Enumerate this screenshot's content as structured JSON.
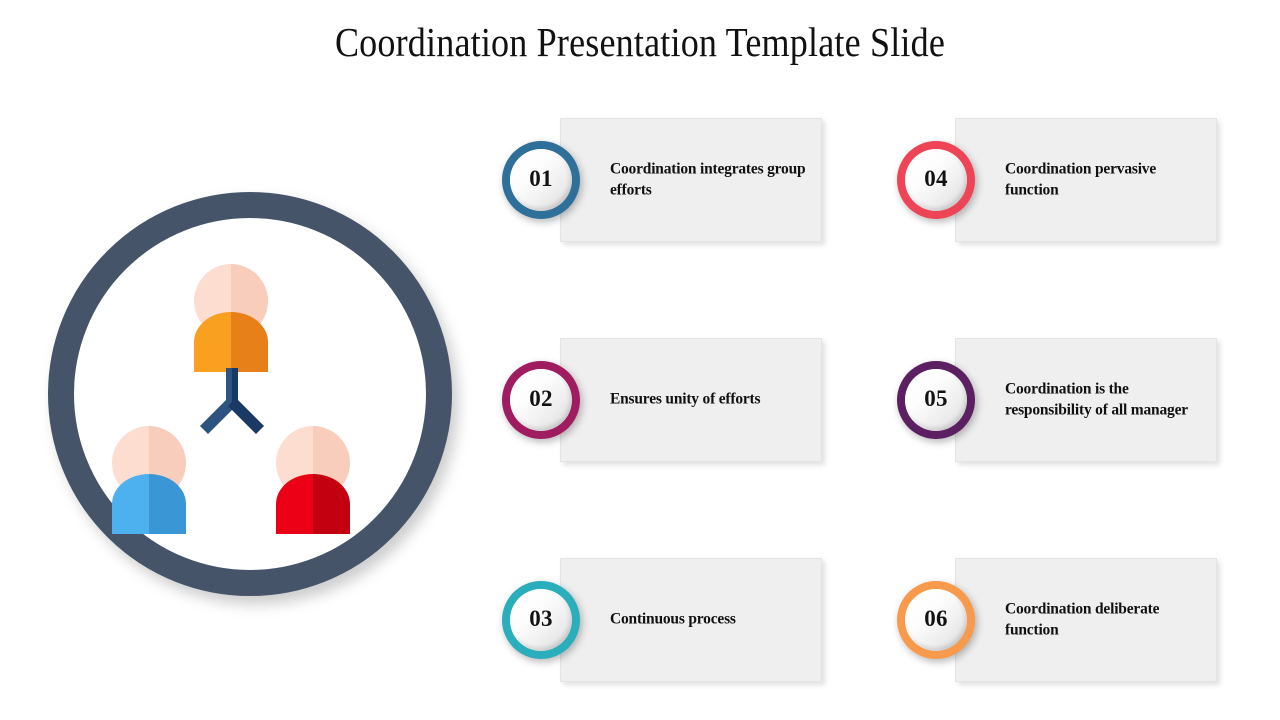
{
  "slide": {
    "title": "Coordination Presentation Template Slide",
    "background": "#ffffff"
  },
  "illustration": {
    "name": "coordination-team-circle-icon",
    "ring_color": "#455468",
    "connector": {
      "left_arm_color": "#2D5480",
      "right_arm_color": "#1B3A63"
    },
    "people": [
      {
        "position": "top",
        "shirt_light": "#F9A020",
        "shirt_dark": "#E8801A",
        "skin_light": "#FCDDD0",
        "skin_dark": "#F8CDBC"
      },
      {
        "position": "bottom-left",
        "shirt_light": "#4DB1F0",
        "shirt_dark": "#3A96D4",
        "skin_light": "#FCDDD0",
        "skin_dark": "#F8CDBC"
      },
      {
        "position": "bottom-right",
        "shirt_light": "#EB0015",
        "shirt_dark": "#C2000F",
        "skin_light": "#FCDDD0",
        "skin_dark": "#F8CDBC"
      }
    ]
  },
  "items": [
    {
      "number": "01",
      "text": "Coordination integrates group efforts",
      "color": "#2E7099"
    },
    {
      "number": "02",
      "text": "Ensures unity of efforts",
      "color": "#A01C60"
    },
    {
      "number": "03",
      "text": "Continuous process",
      "color": "#2AAEBB"
    },
    {
      "number": "04",
      "text": "Coordination pervasive function",
      "color": "#EE4456"
    },
    {
      "number": "05",
      "text": "Coordination is the responsibility of all manager",
      "color": "#5C2062"
    },
    {
      "number": "06",
      "text": "Coordination deliberate function",
      "color": "#F79A4B"
    }
  ]
}
